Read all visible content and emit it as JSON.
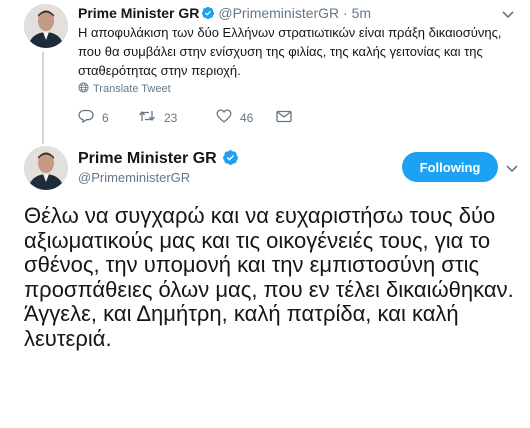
{
  "colors": {
    "accent": "#1da1f2",
    "text": "#14171a",
    "secondary": "#657786",
    "thread_line": "#ccd6dd"
  },
  "parent_tweet": {
    "name": "Prime Minister GR",
    "handle": "@PrimeministerGR",
    "separator": "·",
    "time": "5m",
    "text": "Η αποφυλάκιση των δύο Ελλήνων στρατιωτικών είναι πράξη δικαιοσύνης, που θα συμβάλει στην ενίσχυση της φιλίας, της καλής γειτονίας και της σταθερότητας στην περιοχή.",
    "translate_label": "Translate Tweet",
    "reply_count": "6",
    "retweet_count": "23",
    "like_count": "46",
    "icons": [
      "reply-icon",
      "retweet-icon",
      "like-icon",
      "dm-icon",
      "globe-icon",
      "verified-icon",
      "chevron-down-icon"
    ]
  },
  "main_tweet": {
    "name": "Prime Minister GR",
    "handle": "@PrimeministerGR",
    "follow_label": "Following",
    "text_line_1": "Θέλω να συγχαρώ και να ευχαριστήσω τους δύο αξιωματικούς μας και τις οικογένειές τους, για το σθένος, την υπομονή και την εμπιστοσύνη στις προσπάθειες όλων μας, που εν τέλει δικαιώθηκαν.",
    "text_line_2": "Άγγελε, και Δημήτρη, καλή πατρίδα, και καλή λευτεριά."
  }
}
